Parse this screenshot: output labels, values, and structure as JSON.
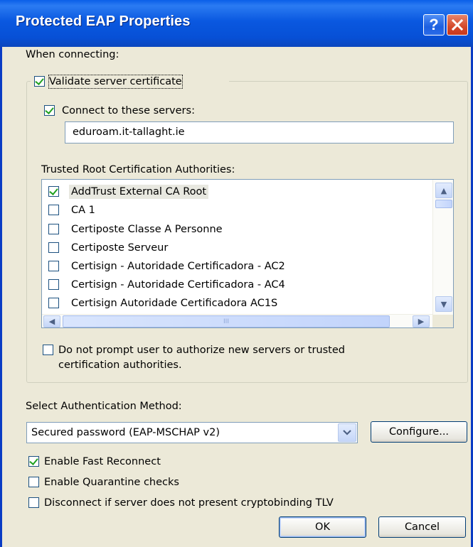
{
  "window": {
    "title": "Protected EAP Properties",
    "help_label": "?",
    "close_label": "✕"
  },
  "when_connecting": "When connecting:",
  "validate_cert": {
    "label": "Validate server certificate",
    "checked": true
  },
  "connect_servers": {
    "label": "Connect to these servers:",
    "checked": true,
    "value": "eduroam.it-tallaght.ie"
  },
  "trusted_roots": {
    "label": "Trusted Root Certification Authorities:",
    "items": [
      {
        "label": "AddTrust External CA Root",
        "checked": true
      },
      {
        "label": "CA 1",
        "checked": false
      },
      {
        "label": "Certiposte Classe A Personne",
        "checked": false
      },
      {
        "label": "Certiposte Serveur",
        "checked": false
      },
      {
        "label": "Certisign - Autoridade Certificadora - AC2",
        "checked": false
      },
      {
        "label": "Certisign - Autoridade Certificadora - AC4",
        "checked": false
      },
      {
        "label": "Certisign Autoridade Certificadora AC1S",
        "checked": false
      }
    ],
    "scroll_up": "▲",
    "scroll_down": "▼",
    "scroll_left": "◀",
    "scroll_right": "▶",
    "thumb_grip": "III"
  },
  "no_prompt": {
    "line1": "Do not prompt user to authorize new servers or trusted",
    "line2": "certification authorities.",
    "checked": false
  },
  "auth_method": {
    "label": "Select Authentication Method:",
    "selected": "Secured password (EAP-MSCHAP v2)",
    "configure_label": "Configure..."
  },
  "options": [
    {
      "label": "Enable Fast Reconnect",
      "checked": true
    },
    {
      "label": "Enable Quarantine checks",
      "checked": false
    },
    {
      "label": "Disconnect if server does not present cryptobinding TLV",
      "checked": false
    }
  ],
  "buttons": {
    "ok": "OK",
    "cancel": "Cancel"
  },
  "colors": {
    "title_bar": "#0a58e0",
    "dialog_bg": "#ece9d8",
    "check_mark": "#21a121",
    "close_button": "#d4492b"
  }
}
